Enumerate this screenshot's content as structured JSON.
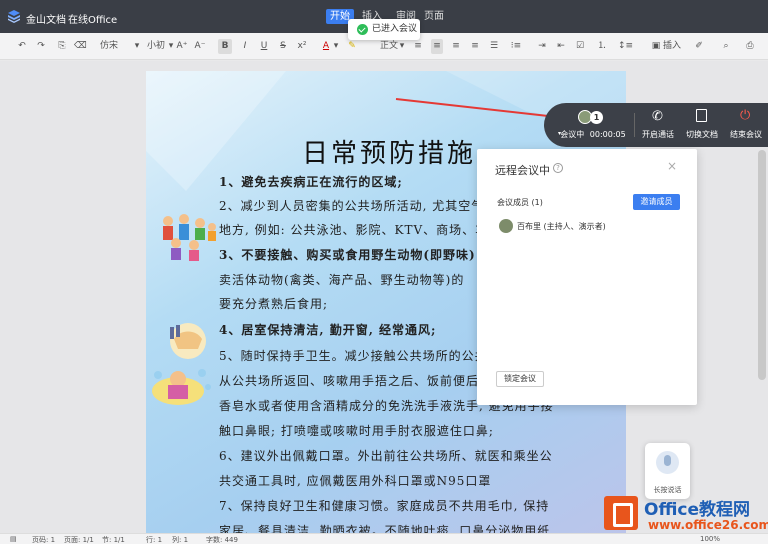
{
  "titlebar": {
    "app_name": "金山文档",
    "online_office": "在线Office",
    "tabs": [
      {
        "label": "开始"
      },
      {
        "label": "插入"
      },
      {
        "label": "审阅"
      },
      {
        "label": "页面"
      }
    ]
  },
  "toast": {
    "text": "已进入会议"
  },
  "toolbar": {
    "font_name": "仿宋",
    "font_size": "小初",
    "bold": "B",
    "italic": "I",
    "underline": "U",
    "strike": "S",
    "font_color": "A",
    "style": "正文",
    "insert": "插入"
  },
  "document": {
    "title": "日常预防措施",
    "lines": [
      "1、避免去疾病正在流行的区域;",
      "2、减少到人员密集的公共场所活动, 尤其空气",
      "地方, 例如: 公共泳池、影院、KTV、商场、车站",
      "3、不要接触、购买或食用野生动物(即野味)",
      "卖活体动物(禽类、海产品、野生动物等)的",
      "要充分煮熟后食用;",
      "4、居室保持清洁, 勤开窗, 经常通风;",
      "5、随时保持手卫生。减少接触公共场所的公共",
      "从公共场所返回、咳嗽用手捂之后、饭前便后",
      "香皂水或者使用含酒精成分的免洗洗手液洗手, 避免用手接",
      "触口鼻眼; 打喷嚏或咳嗽时用手肘衣服遮住口鼻;",
      "6、建议外出佩戴口罩。外出前往公共场所、就医和乘坐公",
      "共交通工具时, 应佩戴医用外科口罩或N95口罩",
      "7、保持良好卫生和健康习惯。家庭成员不共用毛巾, 保持",
      "家居、餐具清洁, 勤晒衣被。不随地吐痰, 口鼻分泌物用纸"
    ]
  },
  "meeting_bar": {
    "count": "1",
    "status": "会议中",
    "time": "00:00:05",
    "call": "开启通话",
    "switch_doc": "切换文档",
    "end": "结束会议"
  },
  "panel": {
    "title": "远程会议中",
    "close": "×",
    "members_label": "会议成员 (1)",
    "invite": "邀请成员",
    "member_name": "百布里 (主持人、演示者)",
    "lock": "锁定会议"
  },
  "voice": {
    "label": "长按说话"
  },
  "statusbar": {
    "page": "页码: 1",
    "pages": "页面: 1/1",
    "section": "节: 1/1",
    "row": "行: 1",
    "col": "列: 1",
    "words": "字数: 449",
    "zoom": "100%"
  },
  "watermark": {
    "title": "Office教程网",
    "url": "www.office26.com"
  },
  "colors": {
    "accent": "#3b7ef0",
    "titlebar": "#3a3e46",
    "arrow": "#e53935",
    "end_meeting": "#ff5a4d"
  }
}
